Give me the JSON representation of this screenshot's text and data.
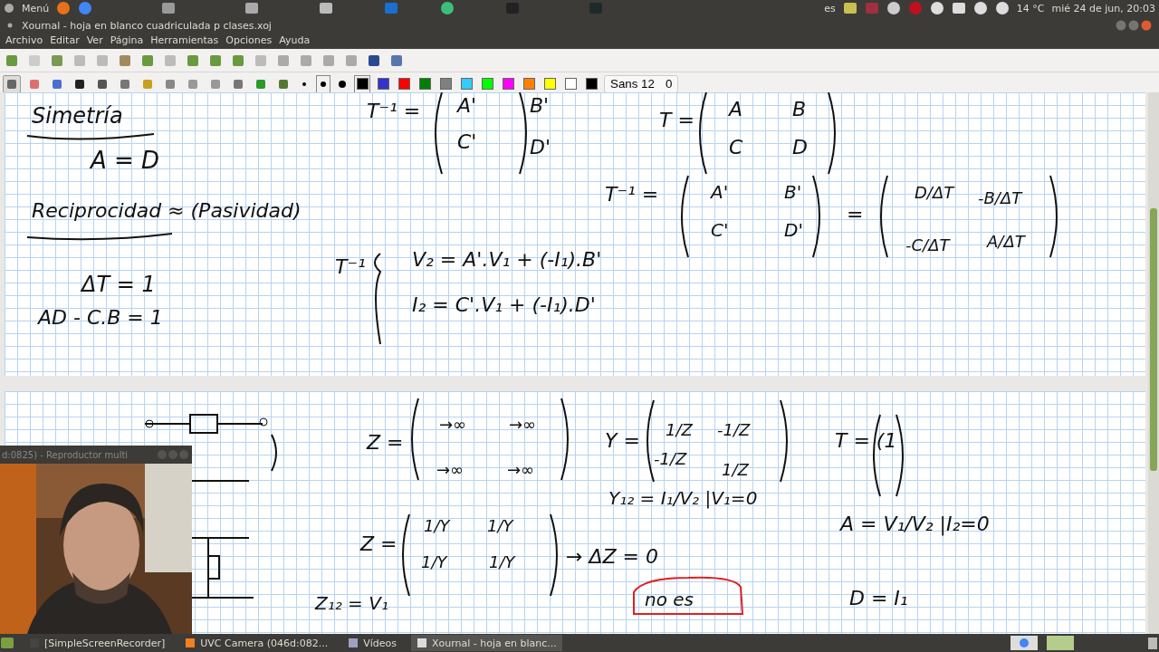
{
  "top_panel": {
    "menu_label": "Menú",
    "keyboard": "es",
    "weather": "14 °C",
    "clock": "mié 24 de jun, 20:03"
  },
  "window": {
    "title": "Xournal - hoja en blanco cuadriculada p clases.xoj",
    "menus": [
      "Archivo",
      "Editar",
      "Ver",
      "Página",
      "Herramientas",
      "Opciones",
      "Ayuda"
    ]
  },
  "tools": [
    {
      "selected": true
    },
    {
      "selected": false
    },
    {
      "selected": false
    },
    {
      "selected": false
    },
    {
      "selected": false
    },
    {
      "selected": false
    },
    {
      "selected": false
    },
    {
      "selected": false
    },
    {
      "selected": false
    },
    {
      "selected": false
    },
    {
      "selected": false
    },
    {
      "selected": false
    },
    {
      "selected": false
    }
  ],
  "pen_sizes": [
    {
      "selected": false
    },
    {
      "selected": true
    },
    {
      "selected": false
    }
  ],
  "colors": [
    {
      "color": "#000000",
      "selected": true
    },
    {
      "color": "#3333cc",
      "selected": false
    },
    {
      "color": "#ff0000",
      "selected": false
    },
    {
      "color": "#008000",
      "selected": false
    },
    {
      "color": "#808080",
      "selected": false
    },
    {
      "color": "#33ccff",
      "selected": false
    },
    {
      "color": "#00ff00",
      "selected": false
    },
    {
      "color": "#ff00ff",
      "selected": false
    },
    {
      "color": "#ff8000",
      "selected": false
    },
    {
      "color": "#ffff00",
      "selected": false
    },
    {
      "color": "#ffffff",
      "selected": false
    },
    {
      "color": "#000000",
      "selected": false
    }
  ],
  "font_button": {
    "font": "Sans 12",
    "size": "0"
  },
  "notes": [
    "Simetría",
    "A = D",
    "Reciprocidad ≈ (Pasividad)",
    "ΔT = 1",
    "AD - C.B = 1",
    "T⁻¹ =",
    "A'",
    "B'",
    "C'",
    "D'",
    "T =",
    "A",
    "B",
    "C",
    "D",
    "T⁻¹ =",
    "A'",
    "B'",
    "C'",
    "D'",
    "=",
    "D/ΔT",
    "-B/ΔT",
    "-C/ΔT",
    "A/ΔT",
    "T⁻¹",
    "V₂ = A'.V₁ + (-I₁).B'",
    "I₂ = C'.V₁ + (-I₁).D'",
    "Z =",
    "→∞",
    "→∞",
    "→∞",
    "→∞",
    "Y =",
    "1/Z",
    "-1/Z",
    "-1/Z",
    "1/Z",
    "Y₁₂ = I₁/V₂ |V₁=0",
    "Z =",
    "1/Y",
    "1/Y",
    "1/Y",
    "1/Y",
    "→ ΔZ = 0",
    "T = (1",
    "A = V₁/V₂ |I₂=0",
    "Z₁₂ = V₁",
    "no es",
    "D = I₁"
  ],
  "video_window": {
    "title": "d:0825) - Reproductor multi"
  },
  "taskbar": [
    {
      "label": "[SimpleScreenRecorder]",
      "selected": false
    },
    {
      "label": "UVC Camera (046d:082...",
      "selected": false
    },
    {
      "label": "Vídeos",
      "selected": false
    },
    {
      "label": "Xournal - hoja en blanc...",
      "selected": true
    }
  ]
}
